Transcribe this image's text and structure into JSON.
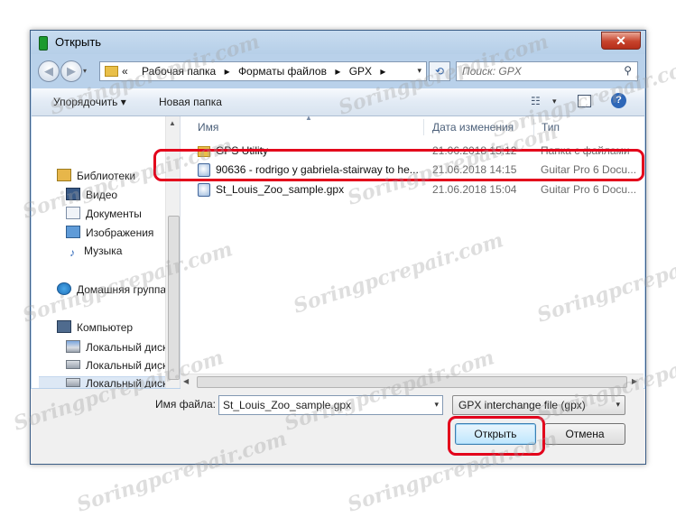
{
  "window": {
    "title": "Открыть",
    "close_label": "✕"
  },
  "address": {
    "history_arrow": "▾",
    "prefix": "«",
    "breadcrumbs": [
      "Рабочая папка",
      "Форматы файлов",
      "GPX"
    ],
    "separator": "▸",
    "dropdown": "▾",
    "refresh_glyph": "⟲"
  },
  "search": {
    "placeholder": "Поиск: GPX",
    "icon": "search-icon"
  },
  "toolbar": {
    "organize_label": "Упорядочить ▾",
    "new_folder_label": "Новая папка",
    "view_glyph": "☷",
    "view_drop": "▾",
    "help_glyph": "?"
  },
  "nav": {
    "items": [
      {
        "label": "Библиотеки",
        "icon": "library-icon"
      },
      {
        "label": "Видео",
        "icon": "video-icon"
      },
      {
        "label": "Документы",
        "icon": "documents-icon"
      },
      {
        "label": "Изображения",
        "icon": "images-icon"
      },
      {
        "label": "Музыка",
        "icon": "music-icon",
        "glyph": "♪"
      },
      {
        "label": "Домашняя группа",
        "icon": "homegroup-icon"
      },
      {
        "label": "Компьютер",
        "icon": "computer-icon"
      },
      {
        "label": "Локальный диск",
        "icon": "windows-drive-icon"
      },
      {
        "label": "Локальный диск",
        "icon": "drive-icon"
      },
      {
        "label": "Локальный диск",
        "icon": "drive-icon",
        "selected": true
      }
    ],
    "scroll_up": "▲",
    "scroll_down": "▼"
  },
  "columns": {
    "name": "Имя",
    "date": "Дата изменения",
    "type": "Тип"
  },
  "files": [
    {
      "name": "GPS Utility",
      "date": "21.06.2018 15:12",
      "type": "Папка с файлами",
      "icon": "folder-icon"
    },
    {
      "name": "90636 - rodrigo y gabriela-stairway to he...",
      "date": "21.06.2018 14:15",
      "type": "Guitar Pro 6 Docu...",
      "icon": "gpx-file-icon"
    },
    {
      "name": "St_Louis_Zoo_sample.gpx",
      "date": "21.06.2018 15:04",
      "type": "Guitar Pro 6 Docu...",
      "icon": "gpx-file-icon"
    }
  ],
  "hscroll": {
    "left": "◀",
    "right": "▶"
  },
  "bottom": {
    "filename_label": "Имя файла:",
    "filename_value": "St_Louis_Zoo_sample.gpx",
    "filetype_value": "GPX interchange file (gpx)",
    "drop": "▾",
    "open_label": "Открыть",
    "cancel_label": "Отмена"
  },
  "annotations": {
    "highlight_color": "#e3001b"
  },
  "watermark": {
    "text": "Soringpcrepair.com"
  }
}
